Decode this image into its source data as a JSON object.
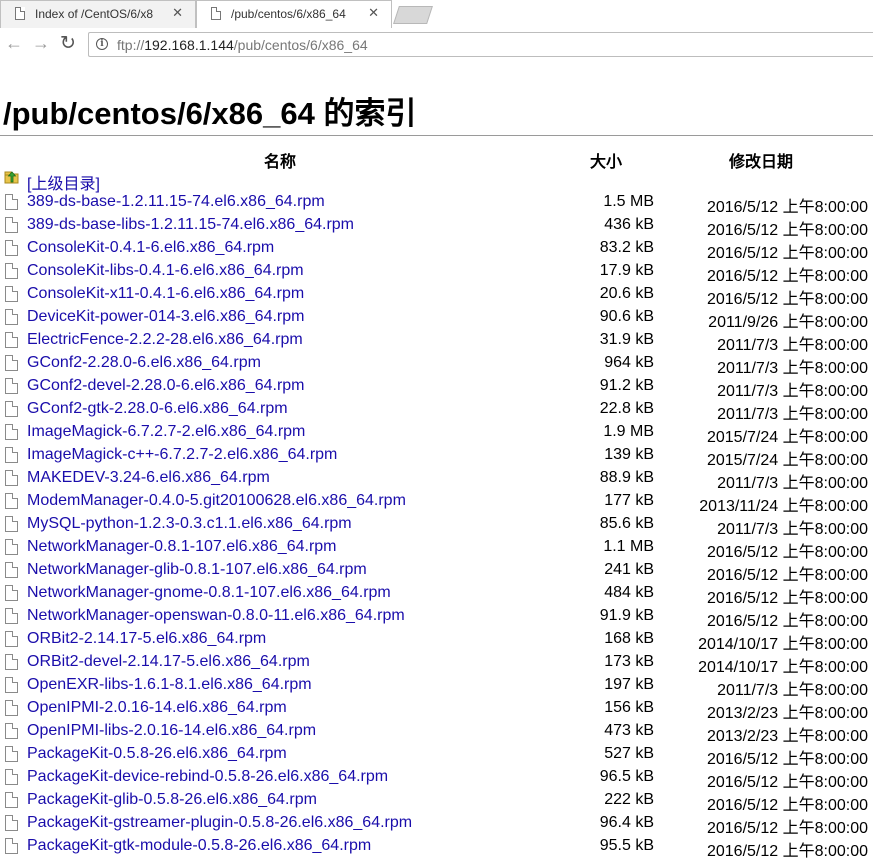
{
  "tabs": [
    {
      "title": "Index of /CentOS/6/x8",
      "close": "✕",
      "active": false
    },
    {
      "title": "/pub/centos/6/x86_64",
      "close": "✕",
      "active": true
    }
  ],
  "toolbar": {
    "back": "←",
    "forward": "→",
    "reload": "↻",
    "url_scheme": "ftp://",
    "url_host": "192.168.1.144",
    "url_path": "/pub/centos/6/x86_64"
  },
  "page": {
    "title": "/pub/centos/6/x86_64 的索引",
    "headers": {
      "name": "名称",
      "size": "大小",
      "date": "修改日期"
    },
    "parent": "[上级目录]",
    "files": [
      {
        "name": "389-ds-base-1.2.11.15-74.el6.x86_64.rpm",
        "size": "1.5 MB",
        "date": "2016/5/12 上午8:00:00"
      },
      {
        "name": "389-ds-base-libs-1.2.11.15-74.el6.x86_64.rpm",
        "size": "436 kB",
        "date": "2016/5/12 上午8:00:00"
      },
      {
        "name": "ConsoleKit-0.4.1-6.el6.x86_64.rpm",
        "size": "83.2 kB",
        "date": "2016/5/12 上午8:00:00"
      },
      {
        "name": "ConsoleKit-libs-0.4.1-6.el6.x86_64.rpm",
        "size": "17.9 kB",
        "date": "2016/5/12 上午8:00:00"
      },
      {
        "name": "ConsoleKit-x11-0.4.1-6.el6.x86_64.rpm",
        "size": "20.6 kB",
        "date": "2016/5/12 上午8:00:00"
      },
      {
        "name": "DeviceKit-power-014-3.el6.x86_64.rpm",
        "size": "90.6 kB",
        "date": "2011/9/26 上午8:00:00"
      },
      {
        "name": "ElectricFence-2.2.2-28.el6.x86_64.rpm",
        "size": "31.9 kB",
        "date": "2011/7/3 上午8:00:00"
      },
      {
        "name": "GConf2-2.28.0-6.el6.x86_64.rpm",
        "size": "964 kB",
        "date": "2011/7/3 上午8:00:00"
      },
      {
        "name": "GConf2-devel-2.28.0-6.el6.x86_64.rpm",
        "size": "91.2 kB",
        "date": "2011/7/3 上午8:00:00"
      },
      {
        "name": "GConf2-gtk-2.28.0-6.el6.x86_64.rpm",
        "size": "22.8 kB",
        "date": "2011/7/3 上午8:00:00"
      },
      {
        "name": "ImageMagick-6.7.2.7-2.el6.x86_64.rpm",
        "size": "1.9 MB",
        "date": "2015/7/24 上午8:00:00"
      },
      {
        "name": "ImageMagick-c++-6.7.2.7-2.el6.x86_64.rpm",
        "size": "139 kB",
        "date": "2015/7/24 上午8:00:00"
      },
      {
        "name": "MAKEDEV-3.24-6.el6.x86_64.rpm",
        "size": "88.9 kB",
        "date": "2011/7/3 上午8:00:00"
      },
      {
        "name": "ModemManager-0.4.0-5.git20100628.el6.x86_64.rpm",
        "size": "177 kB",
        "date": "2013/11/24 上午8:00:00"
      },
      {
        "name": "MySQL-python-1.2.3-0.3.c1.1.el6.x86_64.rpm",
        "size": "85.6 kB",
        "date": "2011/7/3 上午8:00:00"
      },
      {
        "name": "NetworkManager-0.8.1-107.el6.x86_64.rpm",
        "size": "1.1 MB",
        "date": "2016/5/12 上午8:00:00"
      },
      {
        "name": "NetworkManager-glib-0.8.1-107.el6.x86_64.rpm",
        "size": "241 kB",
        "date": "2016/5/12 上午8:00:00"
      },
      {
        "name": "NetworkManager-gnome-0.8.1-107.el6.x86_64.rpm",
        "size": "484 kB",
        "date": "2016/5/12 上午8:00:00"
      },
      {
        "name": "NetworkManager-openswan-0.8.0-11.el6.x86_64.rpm",
        "size": "91.9 kB",
        "date": "2016/5/12 上午8:00:00"
      },
      {
        "name": "ORBit2-2.14.17-5.el6.x86_64.rpm",
        "size": "168 kB",
        "date": "2014/10/17 上午8:00:00"
      },
      {
        "name": "ORBit2-devel-2.14.17-5.el6.x86_64.rpm",
        "size": "173 kB",
        "date": "2014/10/17 上午8:00:00"
      },
      {
        "name": "OpenEXR-libs-1.6.1-8.1.el6.x86_64.rpm",
        "size": "197 kB",
        "date": "2011/7/3 上午8:00:00"
      },
      {
        "name": "OpenIPMI-2.0.16-14.el6.x86_64.rpm",
        "size": "156 kB",
        "date": "2013/2/23 上午8:00:00"
      },
      {
        "name": "OpenIPMI-libs-2.0.16-14.el6.x86_64.rpm",
        "size": "473 kB",
        "date": "2013/2/23 上午8:00:00"
      },
      {
        "name": "PackageKit-0.5.8-26.el6.x86_64.rpm",
        "size": "527 kB",
        "date": "2016/5/12 上午8:00:00"
      },
      {
        "name": "PackageKit-device-rebind-0.5.8-26.el6.x86_64.rpm",
        "size": "96.5 kB",
        "date": "2016/5/12 上午8:00:00"
      },
      {
        "name": "PackageKit-glib-0.5.8-26.el6.x86_64.rpm",
        "size": "222 kB",
        "date": "2016/5/12 上午8:00:00"
      },
      {
        "name": "PackageKit-gstreamer-plugin-0.5.8-26.el6.x86_64.rpm",
        "size": "96.4 kB",
        "date": "2016/5/12 上午8:00:00"
      },
      {
        "name": "PackageKit-gtk-module-0.5.8-26.el6.x86_64.rpm",
        "size": "95.5 kB",
        "date": "2016/5/12 上午8:00:00"
      }
    ]
  }
}
